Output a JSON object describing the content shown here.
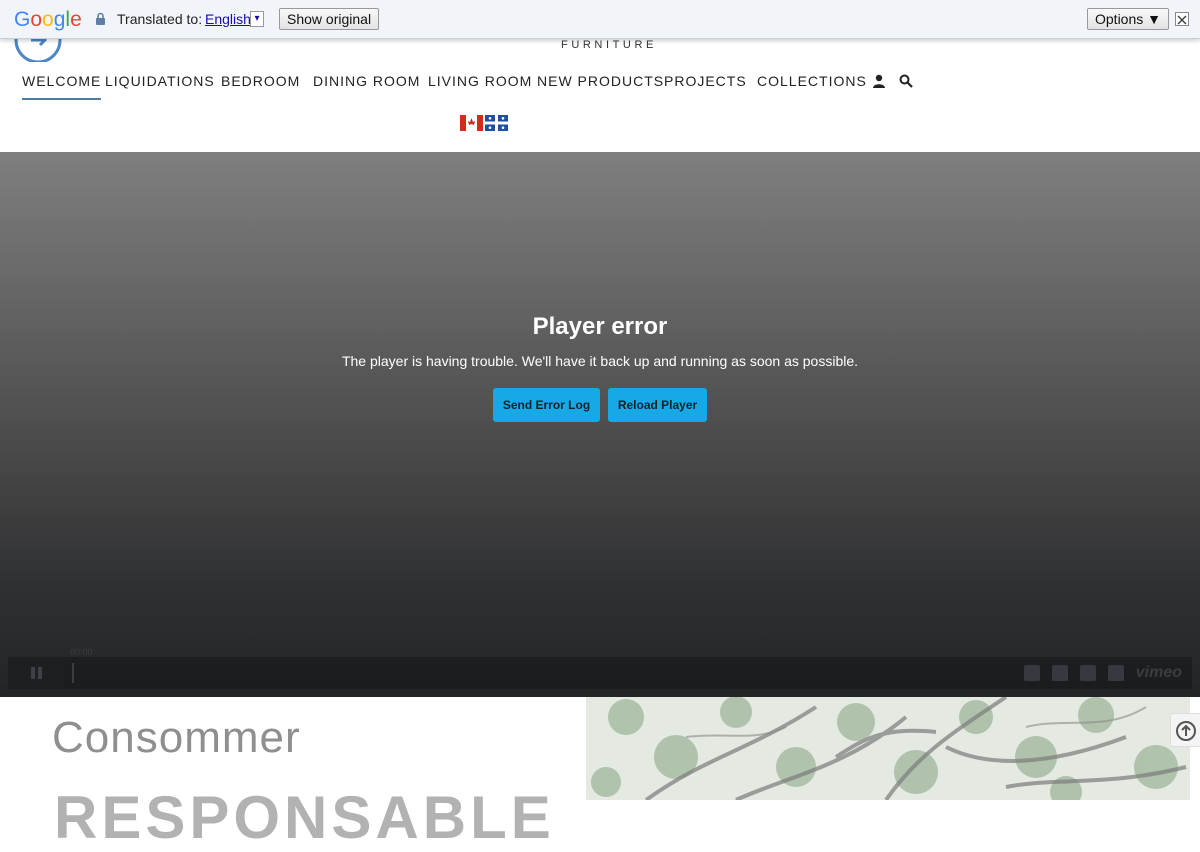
{
  "translate_bar": {
    "logo_text": "Google",
    "translated_label": "Translated to:",
    "language": "English",
    "language_caret": "▾",
    "show_original": "Show original",
    "options": "Options ▼"
  },
  "header": {
    "brand_sub": "FURNITURE",
    "nav": [
      {
        "label": "WELCOME",
        "active": true
      },
      {
        "label": "LIQUIDATIONS"
      },
      {
        "label": "BEDROOM"
      },
      {
        "label": "DINING ROOM"
      },
      {
        "label": "LIVING ROOM"
      },
      {
        "label": "NEW PRODUCTS"
      },
      {
        "label": "PROJECTS"
      },
      {
        "label": "COLLECTIONS"
      }
    ],
    "icons": [
      "user-icon",
      "search-icon"
    ],
    "flags": [
      "canada-flag",
      "quebec-flag"
    ]
  },
  "player": {
    "error_title": "Player error",
    "error_message": "The player is having trouble. We'll have it back up and running as soon as possible.",
    "send_log": "Send Error Log",
    "reload": "Reload Player",
    "time": "00:00",
    "brand": "vimeo"
  },
  "bottom": {
    "line1": "Consommer",
    "line2": "RESPONSABLE"
  },
  "colors": {
    "accent": "#16a9e6",
    "nav_underline": "#4a7fa5"
  }
}
